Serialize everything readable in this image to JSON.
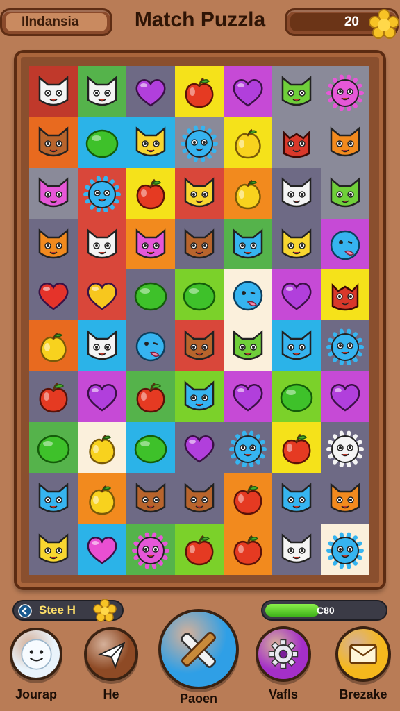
{
  "header": {
    "player_name": "Ilndansia",
    "title": "Match Puzzla",
    "coins": "20",
    "coin_icon": "gold-star-icon"
  },
  "colors": {
    "y": "#f5e21a",
    "o": "#f28a1e",
    "r": "#d9473a",
    "g": "#7bd12a",
    "c": "#2bb3e8",
    "p": "#c64ad6",
    "k": "#8a8a99",
    "w": "#fbf0dc",
    "a": "#55b34b",
    "b": "#6e6a85",
    "m": "#e86a1f",
    "d": "#c0392b"
  },
  "board": {
    "rows": [
      [
        "d:cat-white",
        "a:cat-white",
        "b:heart-purple",
        "y:apple-red",
        "p:heart-purple",
        "k:cat-green",
        "k:furball-pink"
      ],
      [
        "m:cat-brown",
        "c:lime-green",
        "c:cat-yellow",
        "k:furball-blue",
        "y:lemon-yellow",
        "k:monster-red",
        "k:cat-orange"
      ],
      [
        "k:cat-pink",
        "r:furball-blue",
        "y:apple-red",
        "r:cat-yellow",
        "o:lemon-yellow",
        "b:cat-white",
        "k:cat-green"
      ],
      [
        "b:cat-orange",
        "r:cat-white",
        "o:cat-pink",
        "b:cat-brown",
        "a:cat-blue",
        "b:cat-yellow",
        "p:cat-blue-tongue"
      ],
      [
        "b:heart-red",
        "r:heart-yellow",
        "b:lime-green",
        "g:lime-green",
        "w:cat-blue-tongue",
        "p:heart-purple",
        "y:monster-red"
      ],
      [
        "m:lemon-yellow",
        "c:cat-white",
        "b:cat-blue-tongue",
        "r:cat-brown",
        "w:cat-green",
        "c:cat-blue",
        "b:furball-blue"
      ],
      [
        "b:apple-red",
        "p:heart-purple",
        "a:apple-red",
        "g:cat-blue",
        "p:heart-purple",
        "g:lime-green",
        "p:heart-purple"
      ],
      [
        "a:lime-green",
        "w:lemon-yellow",
        "c:lime-green",
        "b:heart-purple",
        "b:furball-blue",
        "y:apple-red",
        "b:furball-white"
      ],
      [
        "b:cat-blue",
        "o:lemon-yellow",
        "b:cat-brown",
        "b:cat-brown",
        "o:apple-red",
        "b:cat-blue",
        "b:cat-orange"
      ],
      [
        "b:cat-yellow",
        "c:heart-pink",
        "a:furball-pink",
        "g:apple-red",
        "o:apple-red",
        "b:cat-white",
        "w:furball-blue"
      ]
    ]
  },
  "hud": {
    "speed_label": "Stee H",
    "progress_text": "C80",
    "progress_fraction": 0.45
  },
  "buttons": [
    {
      "label": "Jourap",
      "icon": "smiley-face-icon",
      "color": "#e9f3fb"
    },
    {
      "label": "He",
      "icon": "paper-plane-icon",
      "color": "#8e4a25"
    },
    {
      "label": "Paoen",
      "icon": "crossed-tools-icon",
      "color": "#2f9fe6"
    },
    {
      "label": "Vafls",
      "icon": "gear-icon",
      "color": "#a42fc8"
    },
    {
      "label": "Brezake",
      "icon": "envelope-icon",
      "color": "#f5b81d"
    }
  ]
}
